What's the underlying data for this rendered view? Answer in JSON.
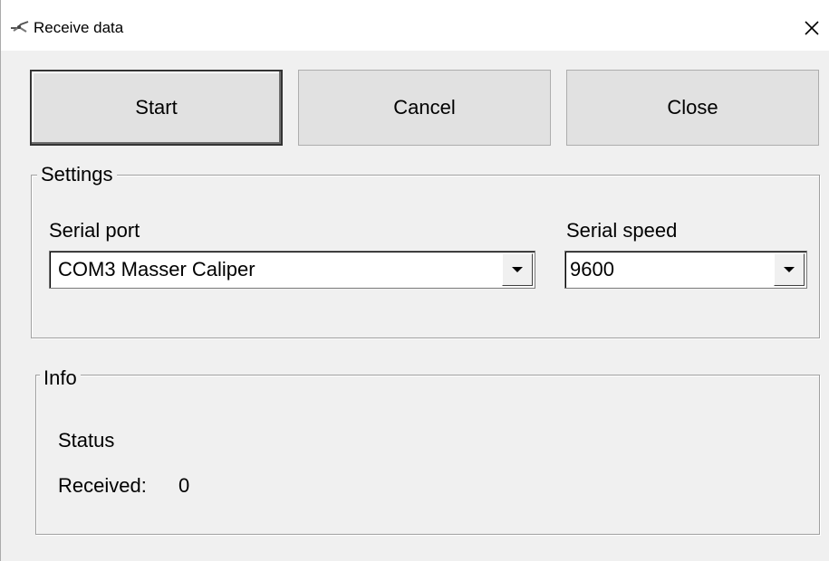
{
  "window": {
    "title": "Receive data",
    "icon": "caliper-icon",
    "close_icon": "close-icon"
  },
  "buttons": {
    "start": "Start",
    "cancel": "Cancel",
    "close": "Close"
  },
  "settings": {
    "legend": "Settings",
    "serial_port_label": "Serial port",
    "serial_port_value": "COM3 Masser Caliper",
    "serial_speed_label": "Serial speed",
    "serial_speed_value": "9600"
  },
  "info": {
    "legend": "Info",
    "status_label": "Status",
    "received_label": "Received:",
    "received_value": "0"
  }
}
